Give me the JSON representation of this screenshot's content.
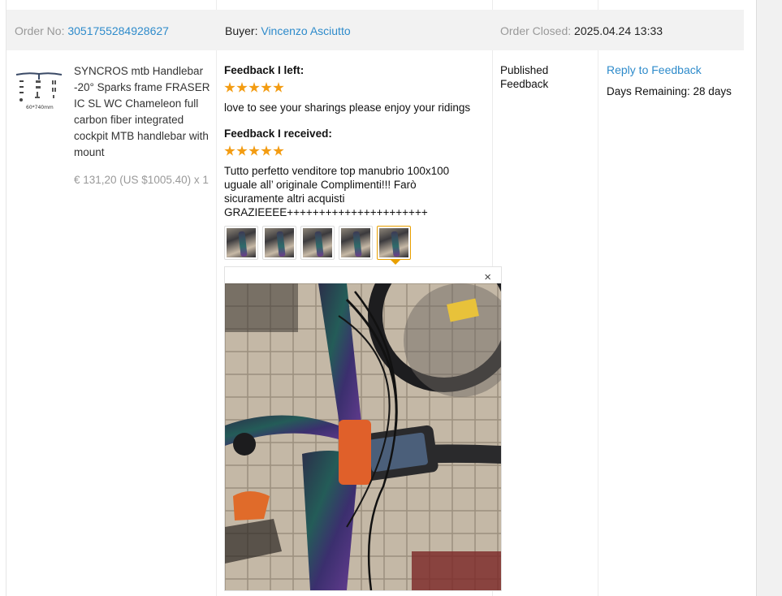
{
  "order": {
    "order_no_label": "Order No:",
    "order_no": "3051755284928627",
    "buyer_label": "Buyer:",
    "buyer": "Vincenzo Asciutto",
    "closed_label": "Order Closed:",
    "closed_date": "2025.04.24 13:33"
  },
  "product": {
    "title": "SYNCROS mtb Handlebar -20° Sparks frame FRASER IC SL WC Chameleon full carbon fiber integrated cockpit MTB handlebar with mount",
    "price": "€ 131,20 (US $1005.40) x 1",
    "thumb_caption": "60*740mm"
  },
  "feedback": {
    "left_heading": "Feedback I left:",
    "left_stars": 5,
    "left_text": "love to see your sharings please enjoy your ridings",
    "received_heading": "Feedback I received:",
    "received_stars": 5,
    "received_text_lines": [
      "Tutto perfetto venditore top manubrio 100x100",
      "uguale all’  originale Complimenti!!! Farò",
      "sicuramente altri acquisti",
      "GRAZIEEEE++++++++++++++++++++++"
    ],
    "photo_count": 5,
    "active_photo": 5,
    "close_icon": "×"
  },
  "status": {
    "line1": "Published",
    "line2": "Feedback"
  },
  "actions": {
    "reply_label": "Reply to Feedback",
    "days_remaining": "Days Remaining: 28 days"
  },
  "colors": {
    "link": "#2e8bcb",
    "star": "#f39c12",
    "active_border": "#e9a000",
    "header_bg": "#f2f2f2"
  }
}
